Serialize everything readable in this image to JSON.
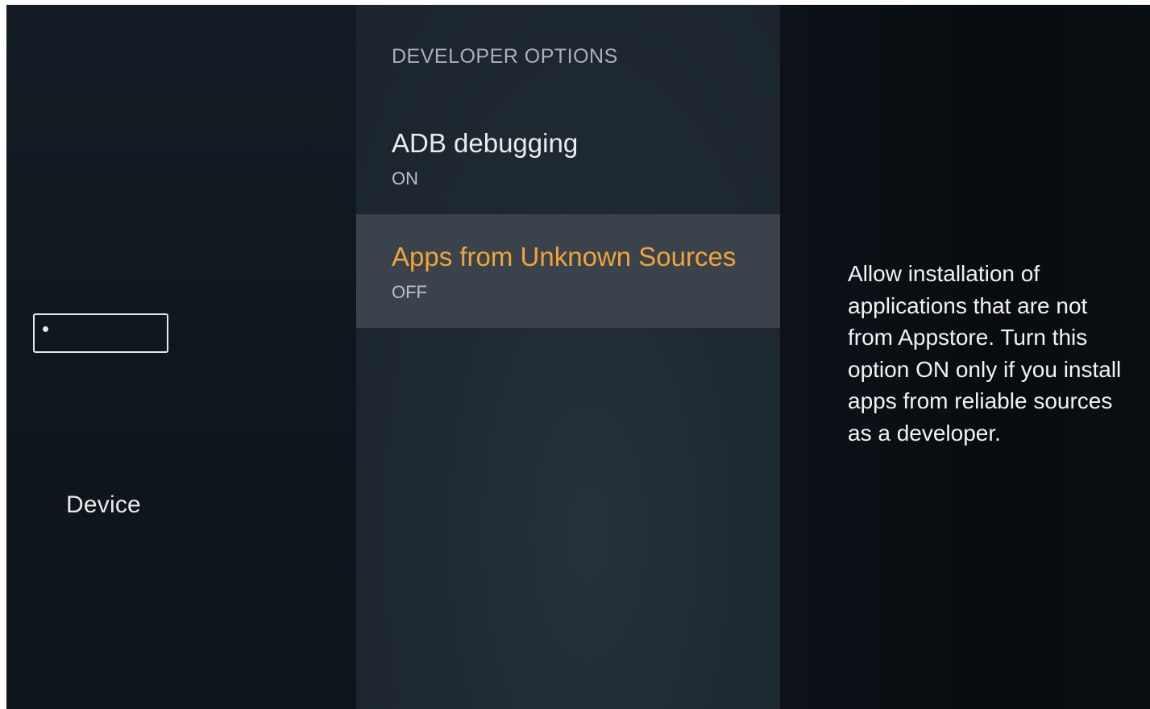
{
  "sidebar": {
    "icon": "fire-tv-stick-device-icon",
    "label": "Device"
  },
  "developer_options": {
    "header": "DEVELOPER OPTIONS",
    "items": [
      {
        "title": "ADB debugging",
        "value": "ON",
        "selected": false
      },
      {
        "title": "Apps from Unknown Sources",
        "value": "OFF",
        "selected": true
      }
    ]
  },
  "info_panel": {
    "description": "Allow installation of applications that are not from Appstore. Turn this option ON only if you install apps from reliable sources as a developer."
  },
  "colors": {
    "highlight_text": "#f2a33a",
    "selected_row_bg": "#3a434b"
  }
}
